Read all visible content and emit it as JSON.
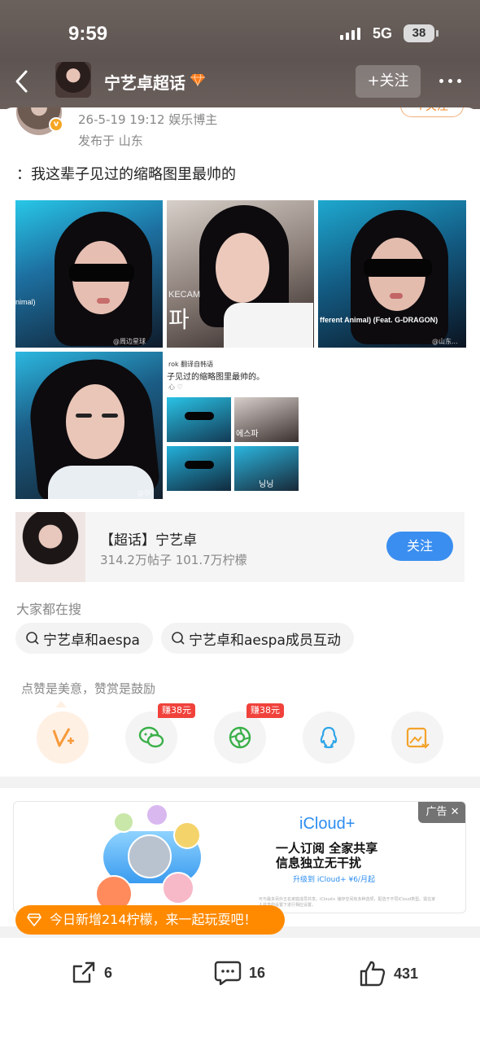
{
  "status": {
    "time": "9:59",
    "network": "5G",
    "battery": "38"
  },
  "header": {
    "title": "宁艺卓超话",
    "follow_label": "+关注"
  },
  "post": {
    "follow_label": "+关注",
    "meta": "26-5-19 19:12  娱乐博主",
    "location": "发布于 山东",
    "text": "：我这辈子见过的缩略图里最帅的",
    "image_captions": {
      "p1": "nimal)",
      "p1_watermark": "@周边星球",
      "p2": "KECAM",
      "p2_big": "파",
      "p3": "fferent Animal) (Feat. G-DRAGON)",
      "p3_watermark": "@山东...",
      "p4_watermark": "@尔维...",
      "p5_line1": "rok 翻译自韩语",
      "p5_line2": "子见过的缩略图里最帅的。",
      "p5_line3": "心 ♡",
      "p5_mini2": "에스파",
      "p5_mini4": "닝닝"
    }
  },
  "topic": {
    "name": "【超话】宁艺卓",
    "stats": "314.2万帖子 101.7万柠檬",
    "follow_label": "关注"
  },
  "search": {
    "heading": "大家都在搜",
    "chips": [
      "宁艺卓和aespa",
      "宁艺卓和aespa成员互动"
    ]
  },
  "reward": {
    "caption": "点赞是美意，赞赏是鼓励",
    "badge1": "赚38元",
    "badge2": "赚38元"
  },
  "ad": {
    "title": "iCloud+",
    "line1": "一人订阅 全家共享",
    "line2": "信息独立无干扰",
    "line3": "升级到 iCloud+ ¥6/月起",
    "fine": "可与最多另外五名家庭成员共享。iCloud+ 储存空间有多种选项，配选于不同iCloud类型。需在家人共享的设置下进行相应设置。",
    "tag": "广告"
  },
  "promo": {
    "text": "今日新增214柠檬，来一起玩耍吧！"
  },
  "actions": {
    "share": "6",
    "comments": "16",
    "likes": "431"
  },
  "colors": {
    "accent": "#ff8a00",
    "follow_blue": "#3a8ef0",
    "badge_red": "#f0423b"
  }
}
